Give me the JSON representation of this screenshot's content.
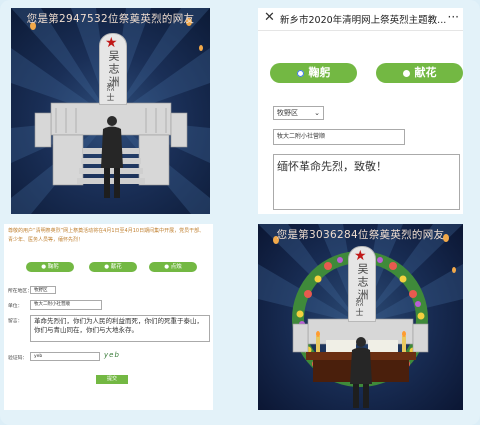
{
  "colors": {
    "green": "#73b843",
    "navy": "#1a2f57",
    "star_red": "#c01818",
    "notice": "#c08030"
  },
  "memorial_top": {
    "banner": "您是第2947532位祭奠英烈的网友",
    "stele_name": "吴志洲",
    "stele_title": "烈士",
    "icons": [
      "star-icon",
      "lantern-icon"
    ]
  },
  "form_top": {
    "close_label": "✕",
    "title": "新乡市2020年清明网上祭英烈主题教...",
    "more_label": "···",
    "bow_button": "鞠躬",
    "flower_button": "献花",
    "district_select": "牧野区",
    "school_field": "牧大二附小社营顺",
    "message_text": "缅怀革命先烈，致敬！"
  },
  "form_bottom": {
    "notice": "尊敬的用户“清明祭英烈”网上祭奠活动将在4月1日至4月10日期间集中开展，党员干部、青少年、医务人员等，缅怀先烈！",
    "bow_button": "鞠躬",
    "flower_button": "献花",
    "candle_button": "点烛",
    "region_label": "所在地区：",
    "region_value": "牧野区",
    "unit_label": "单位：",
    "unit_value": "牧大二附小社营顺",
    "message_label": "留言：",
    "message_text": "革命先烈们，你们为人民的利益而死，你们的死重于泰山，你们与青山同在，你们与大地永存。",
    "captcha_label": "验证码：",
    "captcha_value": "yeb",
    "captcha_image": "yeb",
    "submit_button": "提交"
  },
  "memorial_bottom": {
    "banner": "您是第3036284位祭奠英烈的网友",
    "stele_name": "吴志洲",
    "stele_title": "烈士"
  }
}
